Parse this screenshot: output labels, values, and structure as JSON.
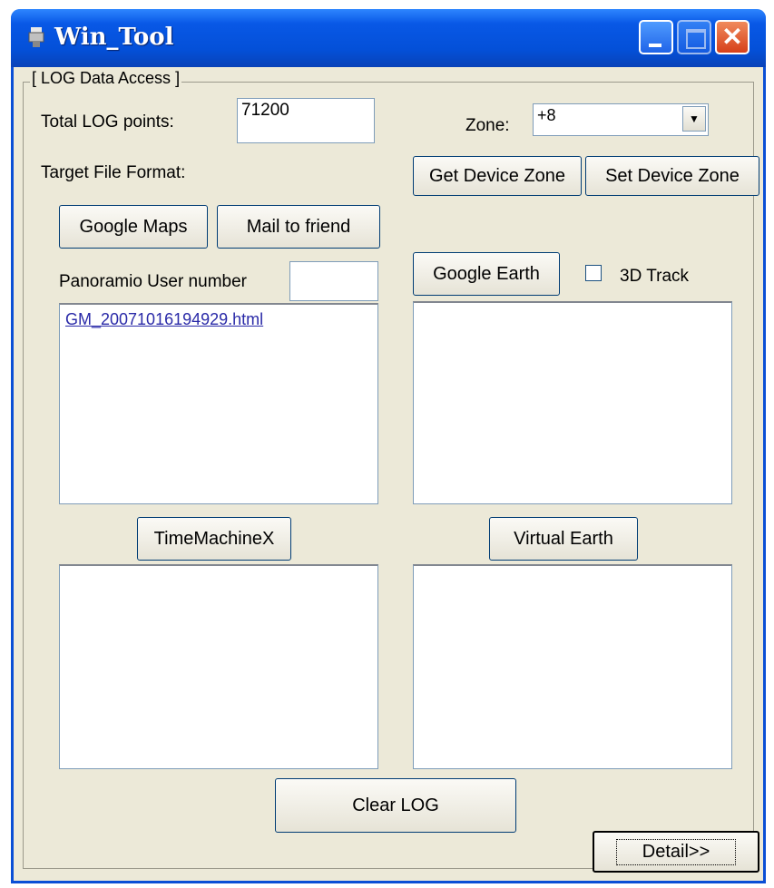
{
  "window": {
    "title": "Win_Tool"
  },
  "group": {
    "legend": "[ LOG Data Access ]"
  },
  "log": {
    "total_label": "Total LOG points:",
    "total_value": "71200"
  },
  "zone": {
    "label": "Zone:",
    "value": "+8"
  },
  "format": {
    "label": "Target File Format:"
  },
  "buttons": {
    "get_zone": "Get Device Zone",
    "set_zone": "Set Device Zone",
    "google_maps": "Google Maps",
    "mail": "Mail to friend",
    "google_earth": "Google Earth",
    "timemachine": "TimeMachineX",
    "virtual_earth": "Virtual Earth",
    "clear_log": "Clear LOG",
    "detail": "Detail>>"
  },
  "panoramio": {
    "label": "Panoramio User number",
    "value": ""
  },
  "track3d": {
    "label": "3D Track",
    "checked": false
  },
  "lists": {
    "google_maps_files": [
      "GM_20071016194929.html"
    ]
  },
  "icons": {
    "app": "app-icon",
    "minimize": "minimize-icon",
    "maximize": "maximize-icon",
    "close": "close-icon",
    "dropdown": "chevron-down-icon"
  },
  "colors": {
    "titlebar": "#0858e6",
    "dialog_bg": "#ece9d8",
    "link": "#2a2aa8",
    "close_button": "#d6401a"
  }
}
